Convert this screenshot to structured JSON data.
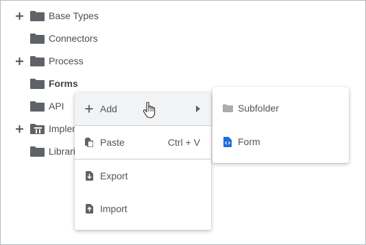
{
  "tree": {
    "items": [
      {
        "label": "Base Types",
        "expandable": true,
        "bold": false,
        "icon": "folder-icon"
      },
      {
        "label": "Connectors",
        "expandable": false,
        "bold": false,
        "icon": "folder-icon"
      },
      {
        "label": "Process",
        "expandable": true,
        "bold": false,
        "icon": "folder-icon"
      },
      {
        "label": "Forms",
        "expandable": false,
        "bold": true,
        "icon": "folder-icon"
      },
      {
        "label": "API",
        "expandable": false,
        "bold": false,
        "icon": "folder-icon"
      },
      {
        "label": "Implementations",
        "expandable": true,
        "bold": false,
        "icon": "implementation-folder-icon"
      },
      {
        "label": "Libraries",
        "expandable": false,
        "bold": false,
        "icon": "folder-icon"
      }
    ]
  },
  "context_menu": {
    "items": [
      {
        "label": "Add",
        "icon": "plus-icon",
        "has_submenu": true
      },
      {
        "label": "Paste",
        "icon": "paste-icon",
        "shortcut": "Ctrl + V"
      },
      {
        "label": "Export",
        "icon": "export-icon"
      },
      {
        "label": "Import",
        "icon": "import-icon"
      }
    ]
  },
  "submenu": {
    "items": [
      {
        "label": "Subfolder",
        "icon": "folder-icon"
      },
      {
        "label": "Form",
        "icon": "form-file-icon"
      }
    ]
  },
  "colors": {
    "folder": "#5f6368",
    "subfolder": "#a9adb1",
    "form_icon": "#1e6fd9",
    "hover": "#f2f3f4"
  }
}
